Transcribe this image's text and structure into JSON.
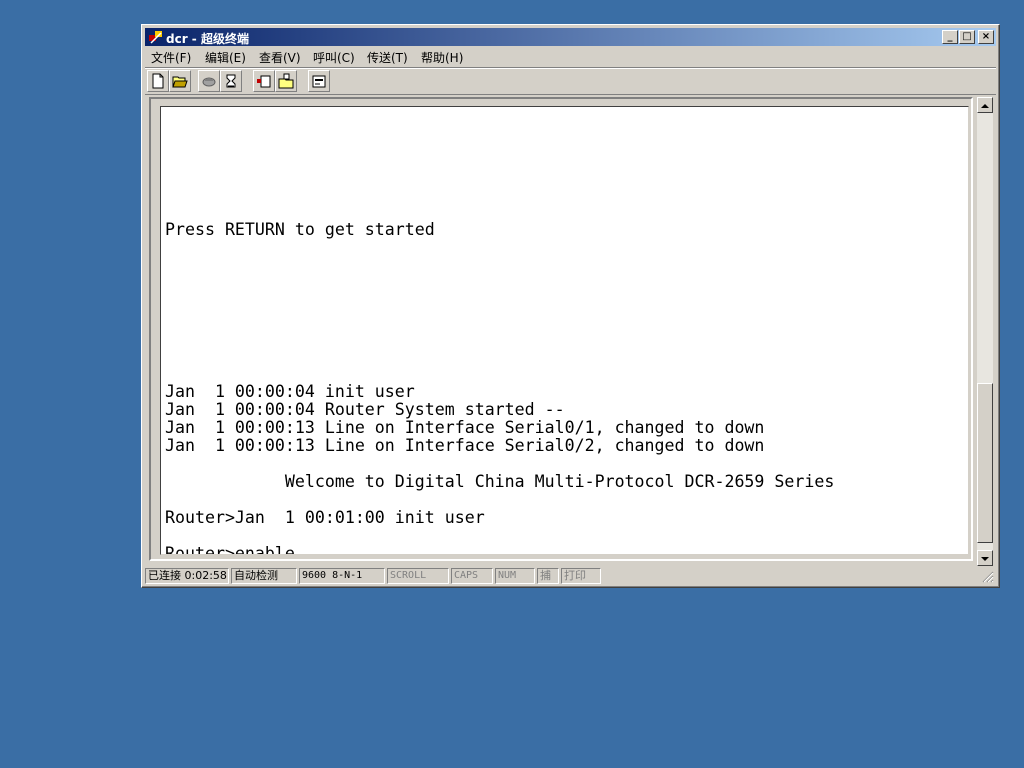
{
  "window": {
    "title": "dcr - 超级终端",
    "icon": "hyperterminal-icon",
    "controls": {
      "minimize": "_",
      "maximize": "□",
      "close": "×"
    }
  },
  "menu": [
    "文件(F)",
    "编辑(E)",
    "查看(V)",
    "呼叫(C)",
    "传送(T)",
    "帮助(H)"
  ],
  "toolbar": [
    {
      "name": "new-icon"
    },
    {
      "name": "open-icon"
    },
    {
      "name": "connect-icon"
    },
    {
      "name": "disconnect-icon"
    },
    {
      "name": "send-icon"
    },
    {
      "name": "receive-icon"
    },
    {
      "name": "properties-icon"
    }
  ],
  "terminal": {
    "text": "\n\n\n\n\n\nPress RETURN to get started\n\n\n\n\n\n\n\n\nJan  1 00:00:04 init user\nJan  1 00:00:04 Router System started --\nJan  1 00:00:13 Line on Interface Serial0/1, changed to down\nJan  1 00:00:13 Line on Interface Serial0/2, changed to down\n\n            Welcome to Digital China Multi-Protocol DCR-2659 Series\n\nRouter>Jan  1 00:01:00 init user\n\nRouter>enable"
  },
  "status": {
    "connected": "已连接 0:02:58",
    "detect": "自动检测",
    "port": "9600 8-N-1",
    "scroll": "SCROLL",
    "caps": "CAPS",
    "num": "NUM",
    "capture": "捕",
    "print": "打印"
  },
  "colors": {
    "desktop": "#3a6ea5",
    "title_start": "#0a246a",
    "title_end": "#a6caf0",
    "chrome": "#d4d0c8"
  }
}
